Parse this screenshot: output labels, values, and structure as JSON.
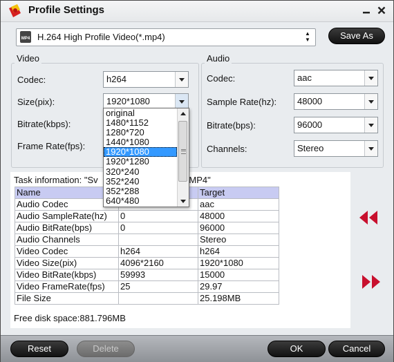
{
  "window": {
    "title": "Profile Settings"
  },
  "profile": {
    "selected": "H.264 High Profile Video(*.mp4)",
    "icon": "mp4-file-icon",
    "icon_text": "MP4"
  },
  "toolbar": {
    "save_as_label": "Save As"
  },
  "video": {
    "group_label": "Video",
    "codec_label": "Codec:",
    "codec_value": "h264",
    "size_label": "Size(pix):",
    "size_value": "1920*1080",
    "bitrate_label": "Bitrate(kbps):",
    "framerate_label": "Frame Rate(fps):"
  },
  "audio": {
    "group_label": "Audio",
    "codec_label": "Codec:",
    "codec_value": "aac",
    "samplerate_label": "Sample Rate(hz):",
    "samplerate_value": "48000",
    "bitrate_label": "Bitrate(bps):",
    "bitrate_value": "96000",
    "channels_label": "Channels:",
    "channels_value": "Stereo"
  },
  "size_dropdown": {
    "options": [
      "original",
      "1480*1152",
      "1280*720",
      "1440*1080",
      "1920*1080",
      "1920*1280",
      "320*240",
      "352*240",
      "352*288",
      "640*480"
    ],
    "selected_index": 4
  },
  "task": {
    "label": "Task information: \"Sv",
    "label_tail": "id.MP4\"",
    "headers": [
      "Name",
      "",
      "Target"
    ],
    "rows": [
      [
        "Audio Codec",
        "",
        "aac"
      ],
      [
        "Audio SampleRate(hz)",
        "0",
        "48000"
      ],
      [
        "Audio BitRate(bps)",
        "0",
        "96000"
      ],
      [
        "Audio Channels",
        "",
        "Stereo"
      ],
      [
        "Video Codec",
        "h264",
        "h264"
      ],
      [
        "Video Size(pix)",
        "4096*2160",
        "1920*1080"
      ],
      [
        "Video BitRate(kbps)",
        "59993",
        "15000"
      ],
      [
        "Video FrameRate(fps)",
        "25",
        "29.97"
      ],
      [
        "File Size",
        "",
        "25.198MB"
      ]
    ],
    "free_disk": "Free disk space:881.796MB"
  },
  "bottom": {
    "reset_label": "Reset",
    "delete_label": "Delete",
    "ok_label": "OK",
    "cancel_label": "Cancel"
  },
  "colors": {
    "accent_red": "#c8102e",
    "selection": "#3399ff",
    "table_header": "#c8cbf2"
  }
}
